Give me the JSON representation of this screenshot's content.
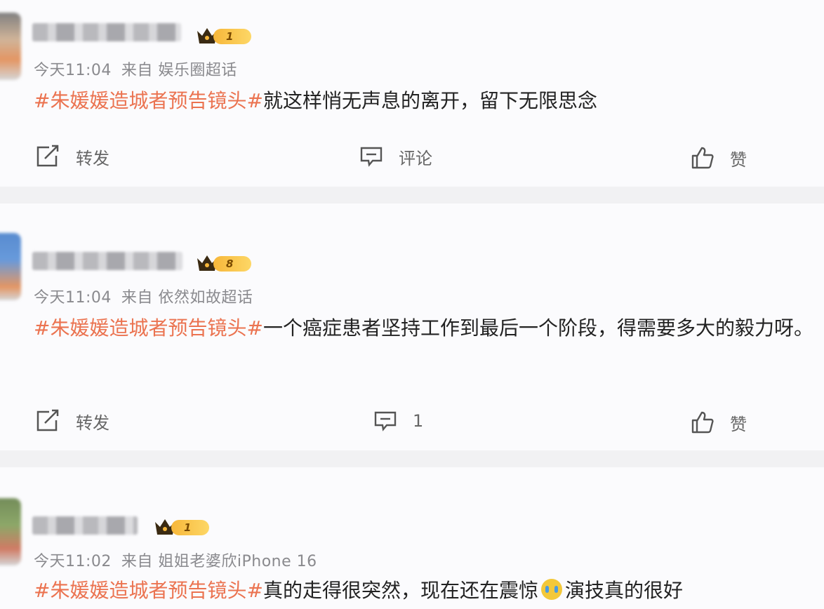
{
  "comments": [
    {
      "level": "1",
      "time": "今天11:04",
      "source": "来自 娱乐圈超话",
      "topic": "#朱媛媛造城者预告镜头#",
      "text": "就这样悄无声息的离开，留下无限思念",
      "actions": {
        "repost": "转发",
        "comment": "评论",
        "like": "赞"
      }
    },
    {
      "level": "8",
      "time": "今天11:04",
      "source": "来自 依然如故超话",
      "topic": "#朱媛媛造城者预告镜头#",
      "text": "一个癌症患者坚持工作到最后一个阶段，得需要多大的毅力呀。",
      "actions": {
        "repost": "转发",
        "comment": "1",
        "like": "赞"
      }
    },
    {
      "level": "1",
      "time": "今天11:02",
      "source": "来自 姐姐老婆欣iPhone 16",
      "topic": "#朱媛媛造城者预告镜头#",
      "text": "真的走得很突然，现在还在震惊",
      "text_after_emoji": "演技真的很好",
      "emoji": "crying-face-emoji"
    }
  ],
  "colors": {
    "topic": "#eb7350",
    "meta": "#8a8a8e",
    "badge": "#f7b73a",
    "background": "#f1f1f3",
    "card": "#fbfbfd"
  },
  "icons": [
    "repost-icon",
    "comment-icon",
    "like-icon",
    "crown-icon"
  ]
}
